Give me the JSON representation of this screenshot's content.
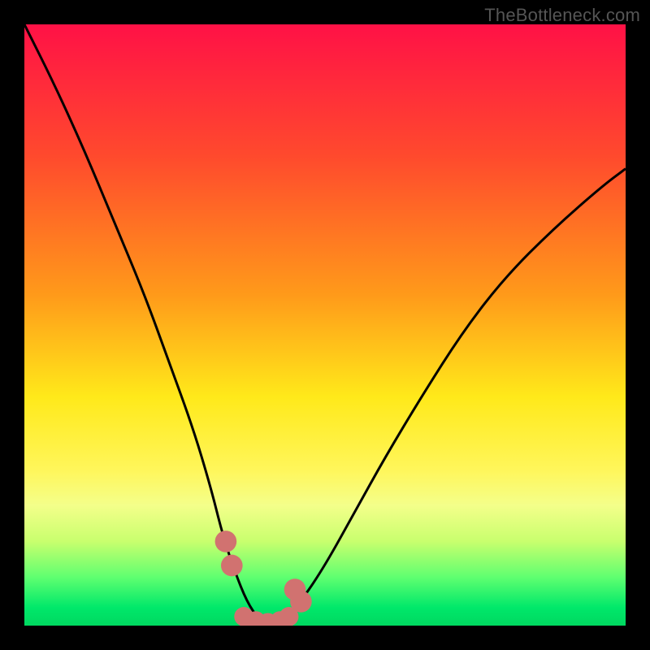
{
  "watermark": "TheBottleneck.com",
  "chart_data": {
    "type": "line",
    "title": "",
    "xlabel": "",
    "ylabel": "",
    "xlim": [
      0,
      100
    ],
    "ylim": [
      0,
      100
    ],
    "gradient_stops": [
      {
        "offset": 0.0,
        "color": "#ff1146"
      },
      {
        "offset": 0.22,
        "color": "#ff4a2d"
      },
      {
        "offset": 0.45,
        "color": "#ff9a1a"
      },
      {
        "offset": 0.62,
        "color": "#ffe91a"
      },
      {
        "offset": 0.74,
        "color": "#fff65a"
      },
      {
        "offset": 0.8,
        "color": "#f4ff8a"
      },
      {
        "offset": 0.86,
        "color": "#c8ff6e"
      },
      {
        "offset": 0.92,
        "color": "#5eff70"
      },
      {
        "offset": 0.97,
        "color": "#00e86a"
      },
      {
        "offset": 1.0,
        "color": "#00d860"
      }
    ],
    "series": [
      {
        "name": "bottleneck-curve",
        "x": [
          0,
          5,
          10,
          15,
          20,
          24,
          28,
          31,
          33,
          35,
          37,
          39,
          41,
          43,
          46,
          50,
          55,
          60,
          66,
          73,
          80,
          88,
          96,
          100
        ],
        "y": [
          100,
          90,
          79,
          67,
          55,
          44,
          33,
          23,
          15,
          9,
          4,
          1,
          0,
          1,
          4,
          10,
          19,
          28,
          38,
          49,
          58,
          66,
          73,
          76
        ]
      }
    ],
    "markers": [
      {
        "name": "left-cluster-upper",
        "x": 33.5,
        "y": 14,
        "r": 1.8
      },
      {
        "name": "left-cluster-lower",
        "x": 34.5,
        "y": 10,
        "r": 1.8
      },
      {
        "name": "right-cluster-upper",
        "x": 45.0,
        "y": 6,
        "r": 1.8
      },
      {
        "name": "right-cluster-lower",
        "x": 46.0,
        "y": 4,
        "r": 1.8
      },
      {
        "name": "bottom-dot-1",
        "x": 36.5,
        "y": 1.5,
        "r": 1.6
      },
      {
        "name": "bottom-dot-2",
        "x": 38.5,
        "y": 0.8,
        "r": 1.6
      },
      {
        "name": "bottom-dot-3",
        "x": 40.5,
        "y": 0.5,
        "r": 1.6
      },
      {
        "name": "bottom-dot-4",
        "x": 42.5,
        "y": 0.8,
        "r": 1.6
      },
      {
        "name": "bottom-dot-5",
        "x": 44.0,
        "y": 1.5,
        "r": 1.6
      }
    ],
    "marker_color": "#d17270"
  }
}
